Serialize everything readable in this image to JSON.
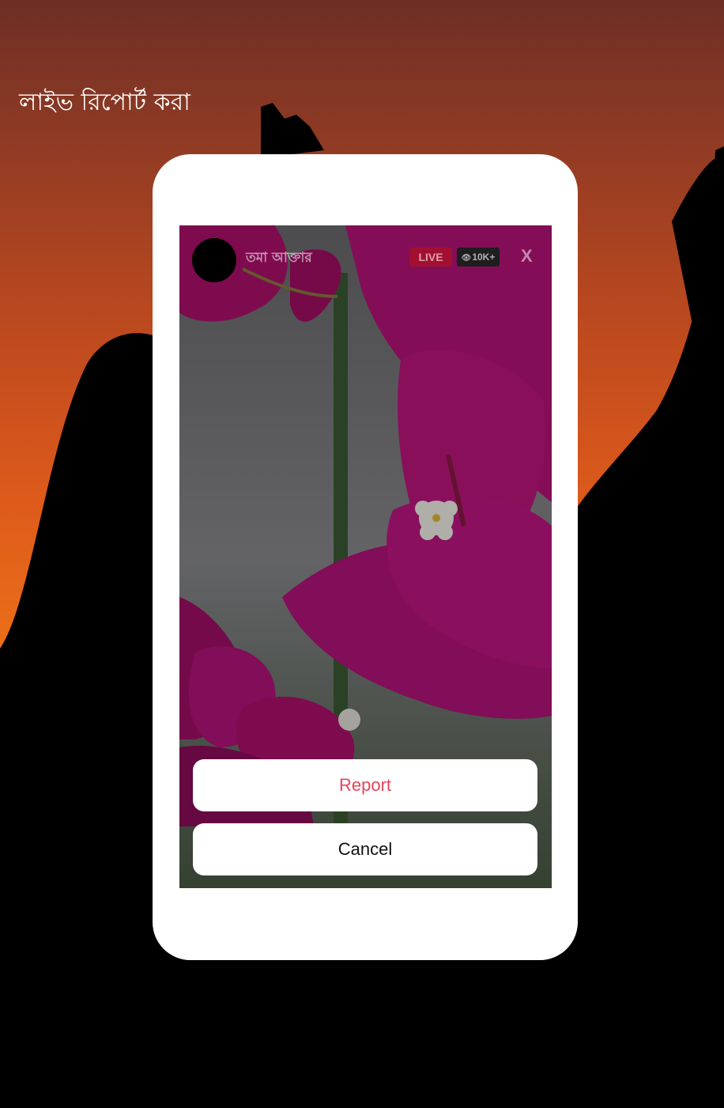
{
  "page": {
    "title": "লাইভ রিপোর্ট করা"
  },
  "stream": {
    "streamer_name": "তমা আক্তার",
    "live_label": "LIVE",
    "viewer_icon": "eye-icon",
    "viewer_count": "10K+",
    "close_label": "X"
  },
  "action_sheet": {
    "report_label": "Report",
    "cancel_label": "Cancel"
  },
  "colors": {
    "report_text": "#e8445a",
    "live_badge": "#a3102f",
    "flower": "#b0106e"
  }
}
